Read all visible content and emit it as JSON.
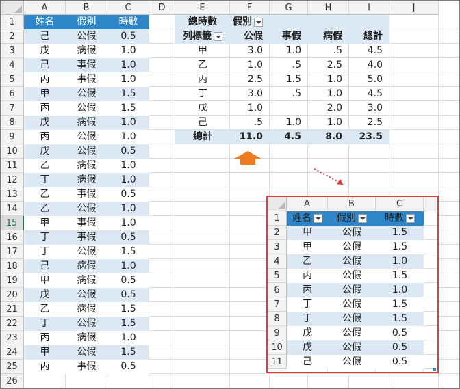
{
  "columns": [
    "A",
    "B",
    "C",
    "D",
    "E",
    "F",
    "G",
    "H",
    "I",
    "J"
  ],
  "rows": [
    "1",
    "2",
    "3",
    "4",
    "5",
    "6",
    "7",
    "8",
    "9",
    "10",
    "11",
    "12",
    "13",
    "14",
    "15",
    "16",
    "17",
    "18",
    "19",
    "20",
    "21",
    "22",
    "23",
    "24",
    "25",
    "26"
  ],
  "selected_row": "15",
  "source_table": {
    "headers": [
      "姓名",
      "假別",
      "時數"
    ],
    "data": [
      [
        "己",
        "公假",
        "0.5"
      ],
      [
        "戊",
        "病假",
        "1.0"
      ],
      [
        "己",
        "事假",
        "1.0"
      ],
      [
        "丙",
        "事假",
        "1.0"
      ],
      [
        "甲",
        "公假",
        "1.5"
      ],
      [
        "丙",
        "公假",
        "1.5"
      ],
      [
        "戊",
        "病假",
        "1.0"
      ],
      [
        "丙",
        "公假",
        "1.0"
      ],
      [
        "戊",
        "公假",
        "0.5"
      ],
      [
        "乙",
        "病假",
        "1.0"
      ],
      [
        "丁",
        "病假",
        "1.0"
      ],
      [
        "乙",
        "事假",
        "0.5"
      ],
      [
        "乙",
        "公假",
        "1.0"
      ],
      [
        "甲",
        "事假",
        "1.0"
      ],
      [
        "丁",
        "事假",
        "0.5"
      ],
      [
        "丁",
        "公假",
        "1.5"
      ],
      [
        "己",
        "病假",
        "1.0"
      ],
      [
        "甲",
        "病假",
        "0.5"
      ],
      [
        "戊",
        "公假",
        "0.5"
      ],
      [
        "乙",
        "病假",
        "1.5"
      ],
      [
        "丁",
        "公假",
        "1.5"
      ],
      [
        "丙",
        "病假",
        "1.0"
      ],
      [
        "甲",
        "公假",
        "1.5"
      ],
      [
        "丙",
        "事假",
        "0.5"
      ]
    ]
  },
  "pivot": {
    "value_field": "總時數",
    "col_field": "假別",
    "row_field": "列標籤",
    "col_headers": [
      "公假",
      "事假",
      "病假",
      "總計"
    ],
    "rows": [
      {
        "label": "甲",
        "values": [
          "3.0",
          "1.0",
          ".5",
          "4.5"
        ]
      },
      {
        "label": "乙",
        "values": [
          "1.0",
          ".5",
          "2.5",
          "4.0"
        ]
      },
      {
        "label": "丙",
        "values": [
          "2.5",
          "1.5",
          "1.0",
          "5.0"
        ]
      },
      {
        "label": "丁",
        "values": [
          "3.0",
          ".5",
          "1.0",
          "4.5"
        ]
      },
      {
        "label": "戊",
        "values": [
          "1.0",
          "",
          "2.0",
          "3.0"
        ]
      },
      {
        "label": "己",
        "values": [
          ".5",
          "1.0",
          "1.0",
          "2.5"
        ]
      }
    ],
    "total_label": "總計",
    "totals": [
      "11.0",
      "4.5",
      "8.0",
      "23.5"
    ]
  },
  "drilldown": {
    "columns": [
      "A",
      "B",
      "C"
    ],
    "rows": [
      "1",
      "2",
      "3",
      "4",
      "5",
      "6",
      "7",
      "8",
      "9",
      "10",
      "11"
    ],
    "headers": [
      "姓名",
      "假別",
      "時數"
    ],
    "data": [
      [
        "甲",
        "公假",
        "1.5"
      ],
      [
        "甲",
        "公假",
        "1.5"
      ],
      [
        "乙",
        "公假",
        "1.0"
      ],
      [
        "丙",
        "公假",
        "1.5"
      ],
      [
        "丙",
        "公假",
        "1.0"
      ],
      [
        "丁",
        "公假",
        "1.5"
      ],
      [
        "丁",
        "公假",
        "1.5"
      ],
      [
        "戊",
        "公假",
        "0.5"
      ],
      [
        "戊",
        "公假",
        "0.5"
      ],
      [
        "己",
        "公假",
        "0.5"
      ]
    ]
  },
  "colors": {
    "table_header": "#2e86c8",
    "band": "#dce9f5",
    "highlight_border": "#e23b3b",
    "arrow": "#f07c22"
  }
}
